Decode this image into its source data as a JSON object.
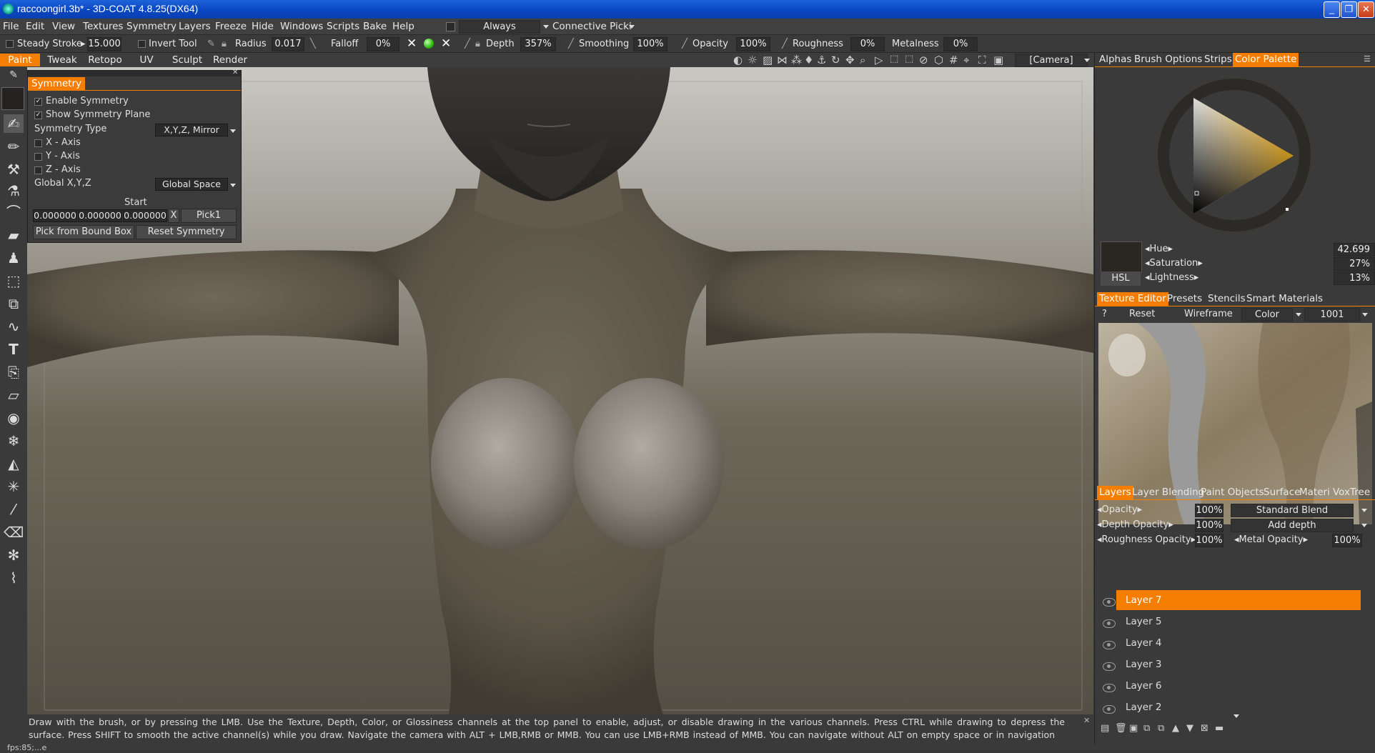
{
  "window": {
    "title": "raccoongirl.3b* - 3D-COAT 4.8.25(DX64)",
    "controls": [
      "_",
      "❐",
      "✕"
    ]
  },
  "menu": {
    "items": [
      "File",
      "Edit",
      "View",
      "Textures",
      "Symmetry",
      "Layers",
      "Freeze",
      "Hide",
      "Windows",
      "Scripts",
      "Bake",
      "Help"
    ],
    "always_value": "Always",
    "connective_value": "Connective Picki"
  },
  "toolbar": {
    "steady_stroke_label": "Steady  Stroke",
    "steady_stroke_value": "15.000",
    "invert_tool_label": "Invert  Tool",
    "radius_label": "Radius",
    "radius_value": "0.017",
    "falloff_label": "Falloff",
    "falloff_value": "0%",
    "depth_label": "Depth",
    "depth_value": "357%",
    "smoothing_label": "Smoothing",
    "smoothing_value": "100%",
    "opacity_label": "Opacity",
    "opacity_value": "100%",
    "roughness_label": "Roughness",
    "roughness_value": "0%",
    "metalness_label": "Metalness",
    "metalness_value": "0%"
  },
  "modes": {
    "items": [
      "Paint",
      "Tweak",
      "Retopo",
      "UV",
      "Sculpt",
      "Render"
    ],
    "active": "Paint",
    "camera_value": "[Camera]"
  },
  "symmetry_panel": {
    "title": "Symmetry",
    "enable_symmetry": "Enable Symmetry",
    "show_symmetry_plane": "Show Symmetry Plane",
    "symmetry_type_label": "Symmetry  Type",
    "symmetry_type_value": "X,Y,Z,  Mirror",
    "x_axis": "X  -  Axis",
    "y_axis": "Y  -  Axis",
    "z_axis": "Z  -  Axis",
    "global_label": "Global  X,Y,Z",
    "global_value": "Global  Space",
    "start_label": "Start",
    "start_x": "0.000000",
    "start_y": "0.000000",
    "start_z": "0.000000",
    "x_btn": "X",
    "pick_btn": "Pick1",
    "pick_bound_box": "Pick  from  Bound  Box",
    "reset_symmetry": "Reset  Symmetry"
  },
  "right_tabs_top": {
    "items": [
      "Alphas",
      "Brush  Options",
      "Strips",
      "Color  Palette"
    ],
    "active": "Color  Palette"
  },
  "color": {
    "swatch": "#2a2621",
    "hue_label": "Hue",
    "hue_value": "42.699",
    "saturation_label": "Saturation",
    "saturation_value": "27%",
    "lightness_label": "Lightness",
    "lightness_value": "13%",
    "mode_btn": "HSL",
    "accent": "#f8b51a"
  },
  "texture_tabs": {
    "items": [
      "Texture  Editor",
      "Presets",
      "Stencils",
      "Smart  Materials"
    ],
    "active": "Texture  Editor",
    "help": "?",
    "reset": "Reset",
    "wireframe": "Wireframe",
    "color_value": "Color",
    "tile_value": "1001"
  },
  "layers_tabs": {
    "items": [
      "Layers",
      "Layer  Blending",
      "Paint  Objects",
      "Surface",
      "Materi",
      "VoxTree"
    ],
    "active": "Layers"
  },
  "layer_props": {
    "opacity_label": "Opacity",
    "opacity_value": "100%",
    "blend_value": "Standard  Blend",
    "depth_opacity_label": "Depth  Opacity",
    "depth_opacity_value": "100%",
    "depth_mode_value": "Add  depth",
    "roughness_opacity_label": "Roughness  Opacity",
    "roughness_opacity_value": "100%",
    "metal_opacity_label": "Metal  Opacity",
    "metal_opacity_value": "100%"
  },
  "layers": [
    "Layer  7",
    "Layer  5",
    "Layer  4",
    "Layer  3",
    "Layer  6",
    "Layer  2"
  ],
  "active_layer": "Layer  7",
  "status": {
    "text": "Draw  with  the  brush,  or  by  pressing  the  LMB.  Use  the  Texture,  Depth,  Color,  or  Glossiness  channels  at  the  top  panel  to  enable,  adjust,  or  disable  drawing  in  the  various  channels.  Press  CTRL  while  drawing  to  depress  the  surface.  Press  SHIFT  to  smooth  the  active  channel(s)  while  you  draw.  Navigate  the  camera  with  ALT  +  LMB,RMB  or  MMB.  You  can  use  LMB+RMB  instead  of  MMB.  You  can  navigate  without  ALT  on  empty  space  or  in  navigation",
    "fps": "fps:85;...e"
  },
  "theme": {
    "accent": "#f57d00",
    "panel": "#3a3a3a"
  }
}
